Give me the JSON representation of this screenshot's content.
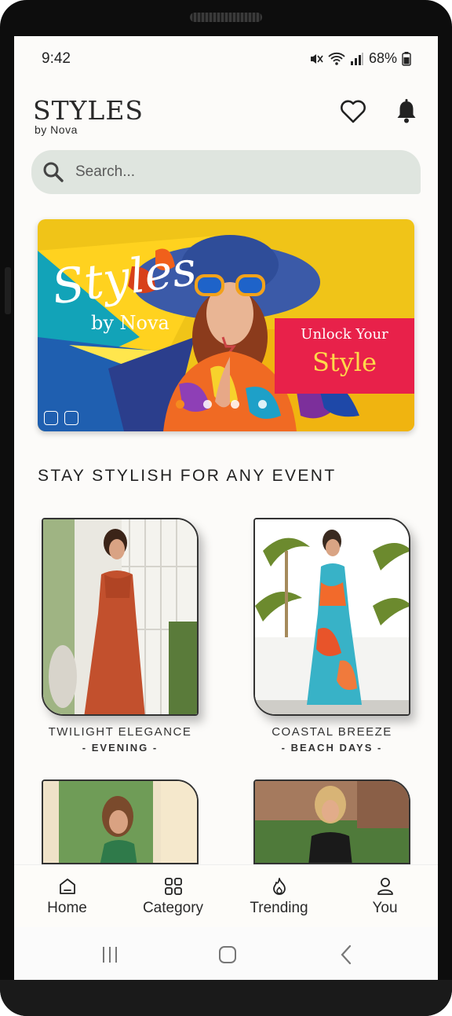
{
  "status": {
    "time": "9:42",
    "battery": "68%"
  },
  "header": {
    "logo_main": "STYLES",
    "logo_sub": "by Nova",
    "icons": [
      "heart-icon",
      "bell-icon"
    ]
  },
  "search": {
    "placeholder": "Search..."
  },
  "banner": {
    "title": "Styles",
    "subtitle": "by Nova",
    "cta_line1": "Unlock Your",
    "cta_line2": "Style",
    "slides": 4,
    "active_slide": 1
  },
  "section": {
    "title": "STAY STYLISH FOR ANY EVENT"
  },
  "events": [
    {
      "name": "TWILIGHT ELEGANCE",
      "tag": "- EVENING -"
    },
    {
      "name": "COASTAL BREEZE",
      "tag": "- BEACH DAYS -"
    },
    {
      "name": "",
      "tag": ""
    },
    {
      "name": "",
      "tag": ""
    }
  ],
  "nav": {
    "items": [
      {
        "label": "Home",
        "icon": "home-icon"
      },
      {
        "label": "Category",
        "icon": "grid-icon"
      },
      {
        "label": "Trending",
        "icon": "flame-icon"
      },
      {
        "label": "You",
        "icon": "user-icon"
      }
    ]
  },
  "colors": {
    "accent_pink": "#e8214a",
    "accent_yellow": "#ffd94a",
    "search_bg": "#dfe5df",
    "dot_active": "#f58b1f"
  }
}
